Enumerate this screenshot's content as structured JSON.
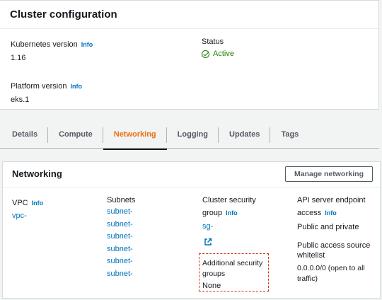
{
  "cluster_config": {
    "title": "Cluster configuration",
    "kubernetes_version": {
      "label": "Kubernetes version",
      "info": "Info",
      "value": "1.16"
    },
    "status": {
      "label": "Status",
      "value": "Active"
    },
    "platform_version": {
      "label": "Platform version",
      "info": "Info",
      "value": "eks.1"
    }
  },
  "tabs": [
    {
      "label": "Details"
    },
    {
      "label": "Compute"
    },
    {
      "label": "Networking",
      "active": true
    },
    {
      "label": "Logging"
    },
    {
      "label": "Updates"
    },
    {
      "label": "Tags"
    }
  ],
  "networking": {
    "title": "Networking",
    "manage_button": "Manage networking",
    "vpc": {
      "label": "VPC",
      "info": "Info",
      "value": "vpc-"
    },
    "subnets": {
      "label": "Subnets",
      "items": [
        "subnet-",
        "subnet-",
        "subnet-",
        "subnet-",
        "subnet-",
        "subnet-"
      ]
    },
    "cluster_security_group": {
      "label_line1": "Cluster security",
      "label_line2": "group",
      "info": "Info",
      "value": "sg-"
    },
    "additional_security_groups": {
      "label_line1": "Additional security",
      "label_line2": "groups",
      "value": "None"
    },
    "api_endpoint": {
      "label_line1": "API server endpoint",
      "label_line2": "access",
      "info": "Info",
      "value": "Public and private"
    },
    "public_source_whitelist": {
      "label_line1": "Public access source",
      "label_line2": "whitelist",
      "value_line1": "0.0.0.0/0 (open to all",
      "value_line2": "traffic)"
    }
  },
  "colors": {
    "link": "#0073bb",
    "active_tab": "#ec7211",
    "status_active": "#1d8102",
    "dashed_highlight": "#d13212"
  }
}
